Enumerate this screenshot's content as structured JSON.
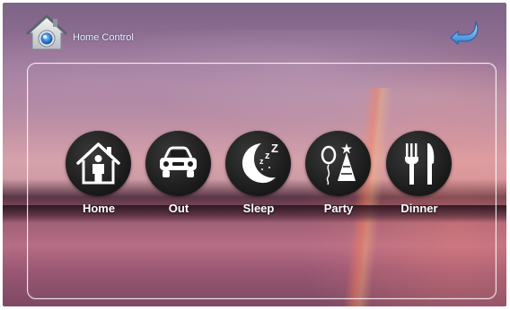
{
  "header": {
    "title": "Home Control",
    "home_icon": "house-home-icon",
    "back_icon": "return-arrow-icon"
  },
  "modes": [
    {
      "label": "Home",
      "icon": "house-person-icon"
    },
    {
      "label": "Out",
      "icon": "car-icon"
    },
    {
      "label": "Sleep",
      "icon": "moon-zzz-icon"
    },
    {
      "label": "Party",
      "icon": "balloon-party-hat-icon"
    },
    {
      "label": "Dinner",
      "icon": "fork-knife-icon"
    }
  ],
  "colors": {
    "button_fill": "#1b1b1b",
    "icon_color": "#ffffff",
    "title_color": "#e9f3ff",
    "accent_blue": "#3a86d6"
  }
}
